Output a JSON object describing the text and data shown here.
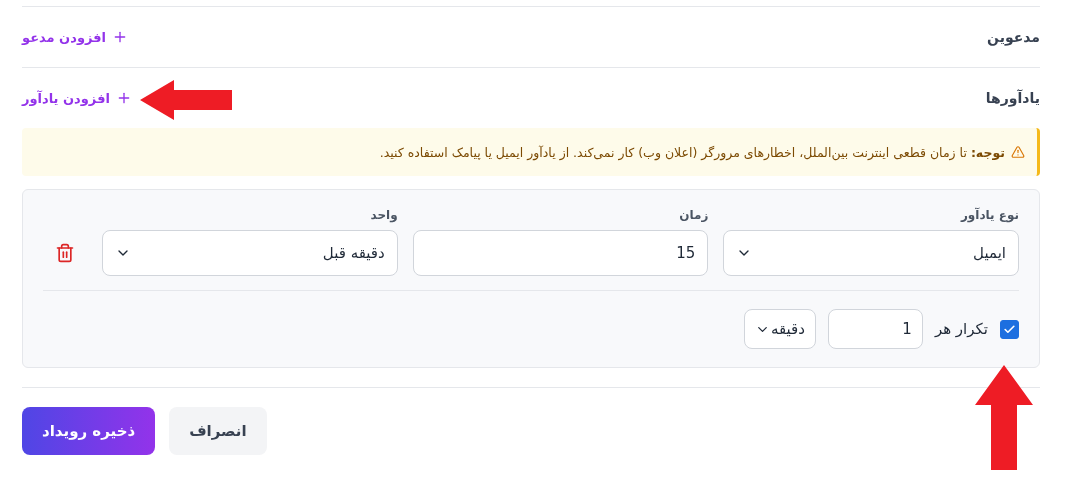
{
  "sections": [
    {
      "label": "مدعوین",
      "action": "افزودن مدعو"
    },
    {
      "label": "یادآورها",
      "action": "افزودن یادآور"
    }
  ],
  "alert": {
    "kind": "warning",
    "text": "**توجه:** تا زمان قطعی اینترنت بین‌الملل، اخطارهای مرورگر (اعلان وب) کار نمی‌کند. از یادآور ایمیل یا پیامک استفاده کنید."
  },
  "reminder": {
    "fields": [
      {
        "kind": "select",
        "label": "نوع یادآور",
        "value": "ایمیل"
      },
      {
        "kind": "input",
        "label": "زمان",
        "value": "15"
      },
      {
        "kind": "select",
        "label": "واحد",
        "value": "دقیقه قبل"
      }
    ],
    "repeat": {
      "checked": true,
      "label": "تکرار هر",
      "count": "1",
      "unit": "دقیقه"
    }
  },
  "buttons": [
    {
      "label": "انصراف",
      "kind": "secondary"
    },
    {
      "label": "ذخیره رویداد",
      "kind": "primary"
    }
  ]
}
